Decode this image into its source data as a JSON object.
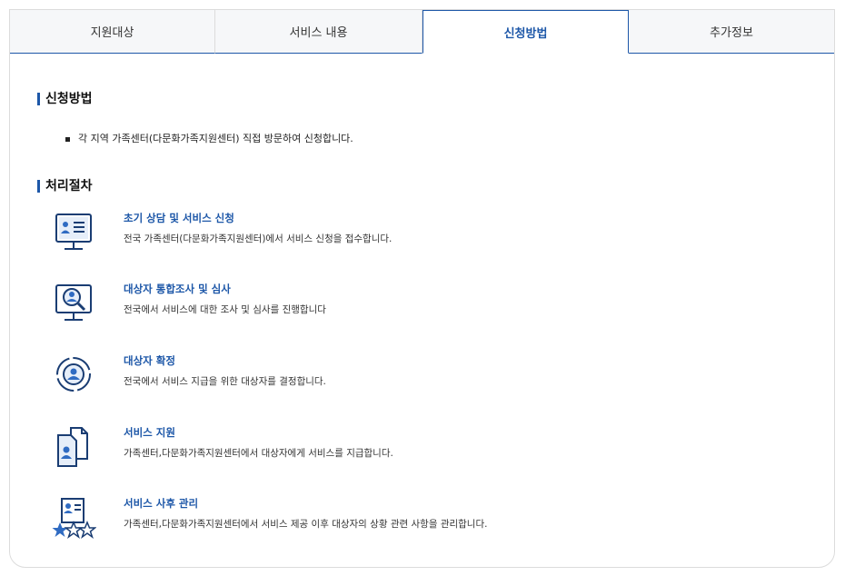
{
  "tabs": [
    {
      "label": "지원대상",
      "active": false
    },
    {
      "label": "서비스 내용",
      "active": false
    },
    {
      "label": "신청방법",
      "active": true
    },
    {
      "label": "추가정보",
      "active": false
    }
  ],
  "apply": {
    "title": "신청방법",
    "bullet": "각 지역 가족센터(다문화가족지원센터) 직접 방문하여 신청합니다."
  },
  "process": {
    "title": "처리절차",
    "steps": [
      {
        "icon": "consultation-monitor-icon",
        "title": "초기 상담 및 서비스 신청",
        "desc": "전국 가족센터(다문화가족지원센터)에서 서비스 신청을 접수합니다."
      },
      {
        "icon": "investigation-search-icon",
        "title": "대상자 통합조사 및 심사",
        "desc": "전국에서 서비스에 대한 조사 및 심사를 진행합니다"
      },
      {
        "icon": "target-person-icon",
        "title": "대상자 확정",
        "desc": "전국에서 서비스 지급을 위한 대상자를 결정합니다."
      },
      {
        "icon": "document-person-icon",
        "title": "서비스 지원",
        "desc": "가족센터,다문화가족지원센터에서 대상자에게 서비스를 지급합니다."
      },
      {
        "icon": "profile-stars-icon",
        "title": "서비스 사후 관리",
        "desc": "가족센터,다문화가족지원센터에서 서비스 제공 이후 대상자의 상황 관련 사항을 관리합니다."
      }
    ]
  },
  "colors": {
    "accent": "#1d57a8",
    "icon": "#1a3d73",
    "border": "#dcdcdc",
    "tab_bg": "#f6f7f9"
  }
}
